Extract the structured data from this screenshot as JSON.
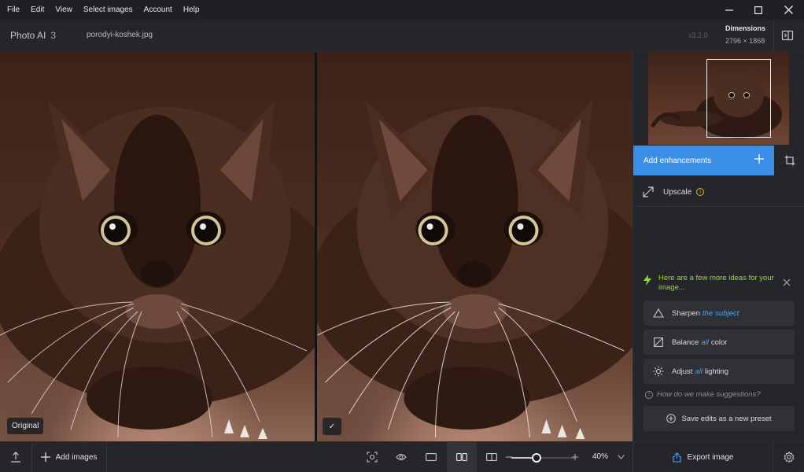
{
  "menu": [
    "File",
    "Edit",
    "View",
    "Select images",
    "Account",
    "Help"
  ],
  "app": {
    "name": "Photo AI",
    "count": "3",
    "file_name": "porodyi-koshek.jpg",
    "version": "v3.2.0"
  },
  "dimensions": {
    "title": "Dimensions",
    "value": "2796 × 1868"
  },
  "viewer": {
    "left_badge": "Original",
    "right_badge": "✓"
  },
  "panel": {
    "add_enhancements": "Add enhancements",
    "upscale_label": "Upscale",
    "info_glyph": "i",
    "ideas_text": "Here are a few more ideas for your image...",
    "suggestions": [
      {
        "verb": "Sharpen",
        "modifier": "the",
        "object": "subject",
        "icon": "triangle-icon"
      },
      {
        "verb": "Balance",
        "modifier": "all",
        "object": "color",
        "icon": "color-balance-icon"
      },
      {
        "verb": "Adjust",
        "modifier": "all",
        "object": "lighting",
        "icon": "sun-icon"
      }
    ],
    "how_text": "How do we make suggestions?",
    "save_preset": "Save edits as a new preset"
  },
  "bottombar": {
    "add_images": "Add images",
    "zoom_value": "40%",
    "zoom_fraction": 0.4,
    "export": "Export image"
  },
  "colors": {
    "accent": "#3a8ee6",
    "ideas": "#9ad640",
    "highlight": "#4da3f0",
    "info": "#d8b829"
  }
}
